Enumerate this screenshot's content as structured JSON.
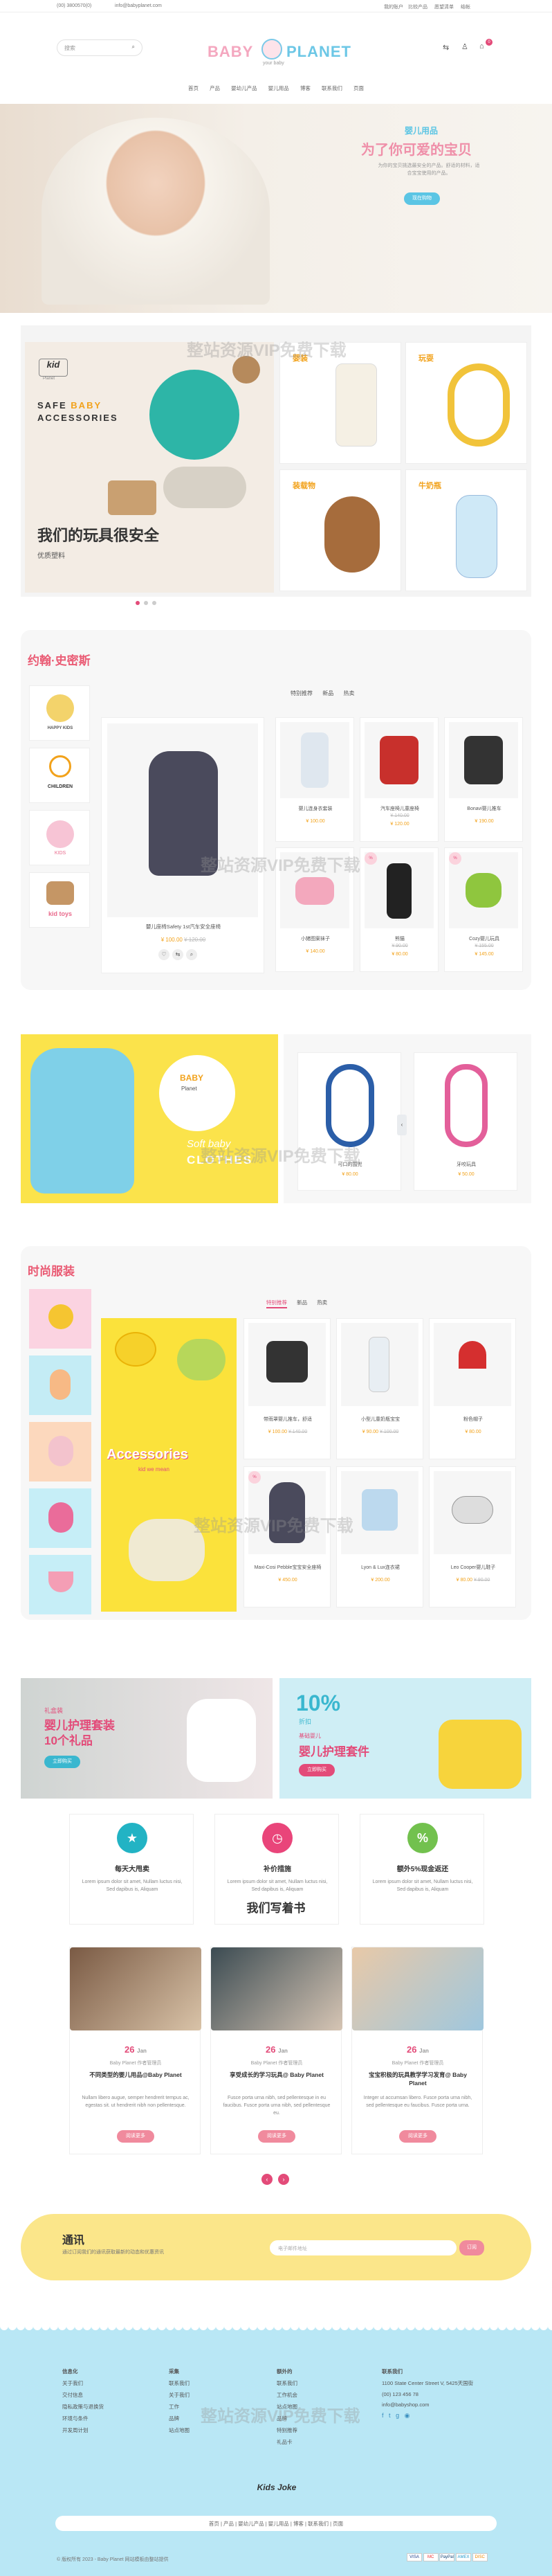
{
  "topbar": {
    "phone": "(00) 3800570(0)",
    "email": "info@babyplanet.com",
    "links": [
      "我的账户",
      "比较产品",
      "愿望清单",
      "结帐"
    ]
  },
  "header": {
    "search_placeholder": "搜索",
    "logo_left": "BABY",
    "logo_right": "PLANET",
    "logo_sub": "your baby",
    "cart_count": "0"
  },
  "nav": [
    "首页",
    "产品",
    "婴幼儿产品",
    "婴儿用品",
    "博客",
    "联系我们",
    "页面"
  ],
  "hero": {
    "kicker": "婴儿用品",
    "title": "为了你可爱的宝贝",
    "desc": "为你的宝贝挑选最安全的产品。舒适的材料，适合宝宝使用的产品。",
    "button": "现在购物"
  },
  "promo": {
    "kid": "kid",
    "kid_sub": "Planet",
    "line1": "SAFE",
    "line1b": "BABY",
    "line2": "ACCESSORIES",
    "title": "我们的玩具很安全",
    "subtitle": "优质塑料",
    "tiles": [
      {
        "label": "婴装"
      },
      {
        "label": "玩耍"
      },
      {
        "label": "装载物"
      },
      {
        "label": "牛奶瓶"
      }
    ]
  },
  "brands": {
    "title": "约翰·史密斯",
    "tabs": [
      "特别推荐",
      "新品",
      "热卖"
    ],
    "logos": [
      "HAPPY KIDS",
      "CHILDREN",
      "KIDS",
      "kid toys"
    ],
    "featured": {
      "name": "嬰儿座椅Safety 1st汽车安全座椅",
      "price": "¥ 100.00",
      "old": "¥ 120.00"
    },
    "products": [
      {
        "name": "婴儿连身衣套装",
        "price": "¥ 100.00",
        "old": ""
      },
      {
        "name": "汽车座椅儿童座椅",
        "price": "¥ 120.00",
        "old": "¥ 140.00"
      },
      {
        "name": "Bonavi婴儿推车",
        "price": "¥ 190.00",
        "old": ""
      },
      {
        "name": "小猪图案袜子",
        "price": "¥ 140.00",
        "old": ""
      },
      {
        "name": "熊猫",
        "price": "¥ 80.00",
        "old": "¥ 90.00"
      },
      {
        "name": "Cozy婴儿玩具",
        "price": "¥ 145.00",
        "old": "¥ 155.00"
      }
    ]
  },
  "banner2": {
    "brand": "BABY",
    "brand2": "Planet",
    "soft": "Soft baby",
    "clothes": "CLOTHES",
    "items": [
      {
        "name": "可口的围兜",
        "price": "¥ 80.00"
      },
      {
        "name": "牙咬玩具",
        "price": "¥ 50.00"
      }
    ]
  },
  "fashion": {
    "title": "时尚服装",
    "tabs": [
      "特别推荐",
      "新品",
      "热卖"
    ],
    "accessories": "Accessories",
    "acc_sub": "kid we mean",
    "products": [
      {
        "name": "带雨罩婴儿推车，舒适",
        "price": "¥ 100.00",
        "old": "¥ 140.00"
      },
      {
        "name": "小型儿童奶瓶宝宝",
        "price": "¥ 90.00",
        "old": "¥ 100.00"
      },
      {
        "name": "粉色帽子",
        "price": "¥ 80.00",
        "old": ""
      },
      {
        "name": "Maxi-Cosi Pebble宝宝安全座椅",
        "price": "¥ 450.00",
        "old": ""
      },
      {
        "name": "Lyon & Lux连衣裙",
        "price": "¥ 200.00",
        "old": ""
      },
      {
        "name": "Leo Cooper婴儿鞋子",
        "price": "¥ 80.00",
        "old": "¥ 90.00"
      }
    ]
  },
  "offers": [
    {
      "kicker": "礼盒装",
      "title": "婴儿护理套装",
      "sub": "10个礼品",
      "button": "立即购买"
    },
    {
      "pct": "10%",
      "off": "折扣",
      "kicker": "基础婴儿",
      "title": "婴儿护理套件",
      "button": "立即购买"
    }
  ],
  "features": [
    {
      "icon": "★",
      "title": "每天大甩卖",
      "desc": "Lorem ipsum dolor sit amet, Nullam luctus nisi, Sed dapibus is, Aliquam",
      "color": "#22b3c4"
    },
    {
      "icon": "◷",
      "title": "补价措施",
      "desc": "Lorem ipsum dolor sit amet, Nullam luctus nisi, Sed dapibus is, Aliquam",
      "color": "#e9457a"
    },
    {
      "icon": "%",
      "title": "额外5%现金返还",
      "desc": "Lorem ipsum dolor sit amet, Nullam luctus nisi, Sed dapibus is, Aliquam",
      "color": "#72c14e"
    }
  ],
  "blog": {
    "title": "我们写着书",
    "posts": [
      {
        "day": "26",
        "mon": "Jan",
        "author": "Baby Planet 作者管理员",
        "title": "不同类型的婴儿用品@Baby Planet",
        "desc": "Nullam libero augue, semper hendrerit tempus ac, egestas sit. ut hendrerit nibh non pellentesque.",
        "button": "阅读更多"
      },
      {
        "day": "26",
        "mon": "Jan",
        "author": "Baby Planet 作者管理员",
        "title": "享受成长的学习玩具@ Baby Planet",
        "desc": "Fusce porta urna nibh, sed pellentesque in eu faucibus. Fusce porta urna nibh, sed pellentesque eu.",
        "button": "阅读更多"
      },
      {
        "day": "26",
        "mon": "Jan",
        "author": "Baby Planet 作者管理员",
        "title": "宝宝积极的玩具教学学习发育@ Baby Planet",
        "desc": "Integer ut accumsan libero. Fusce porta urna nibh, sed pellentesque eu faucibus. Fusce porta urna.",
        "button": "阅读更多"
      }
    ]
  },
  "newsletter": {
    "title": "通讯",
    "desc": "通过订阅我们的通讯获取最新的动态和优惠资讯",
    "placeholder": "电子邮件地址",
    "button": "订阅"
  },
  "footer": {
    "col1": {
      "title": "信息化",
      "items": [
        "关于我们",
        "交付信息",
        "隐私政策与退换货",
        "环境与条件",
        "开发周计划"
      ]
    },
    "col2": {
      "title": "采集",
      "items": [
        "联系我们",
        "关于我们",
        "工作",
        "品牌",
        "站点地图"
      ]
    },
    "col3": {
      "title": "额外的",
      "items": [
        "联系我们",
        "工作机会",
        "站点地图",
        "品牌",
        "特别推荐",
        "礼品卡"
      ]
    },
    "col4": {
      "title": "联系我们",
      "address": "1100 State Center Street V, 5425天国街",
      "phone": "(00) 123 456 78",
      "email": "info@babyshop.com"
    },
    "logo": "Kids Joke",
    "nav": [
      "首页",
      "产品",
      "婴幼儿产品",
      "婴儿用品",
      "博客",
      "联系我们",
      "页面"
    ],
    "copyright": "© 版权所有 2023 - Baby Planet 网站模板由整站提供",
    "payments": [
      "VISA",
      "MC",
      "PayPal",
      "AMEX",
      "DISC"
    ]
  },
  "watermark": "整站资源VIP免费下载"
}
